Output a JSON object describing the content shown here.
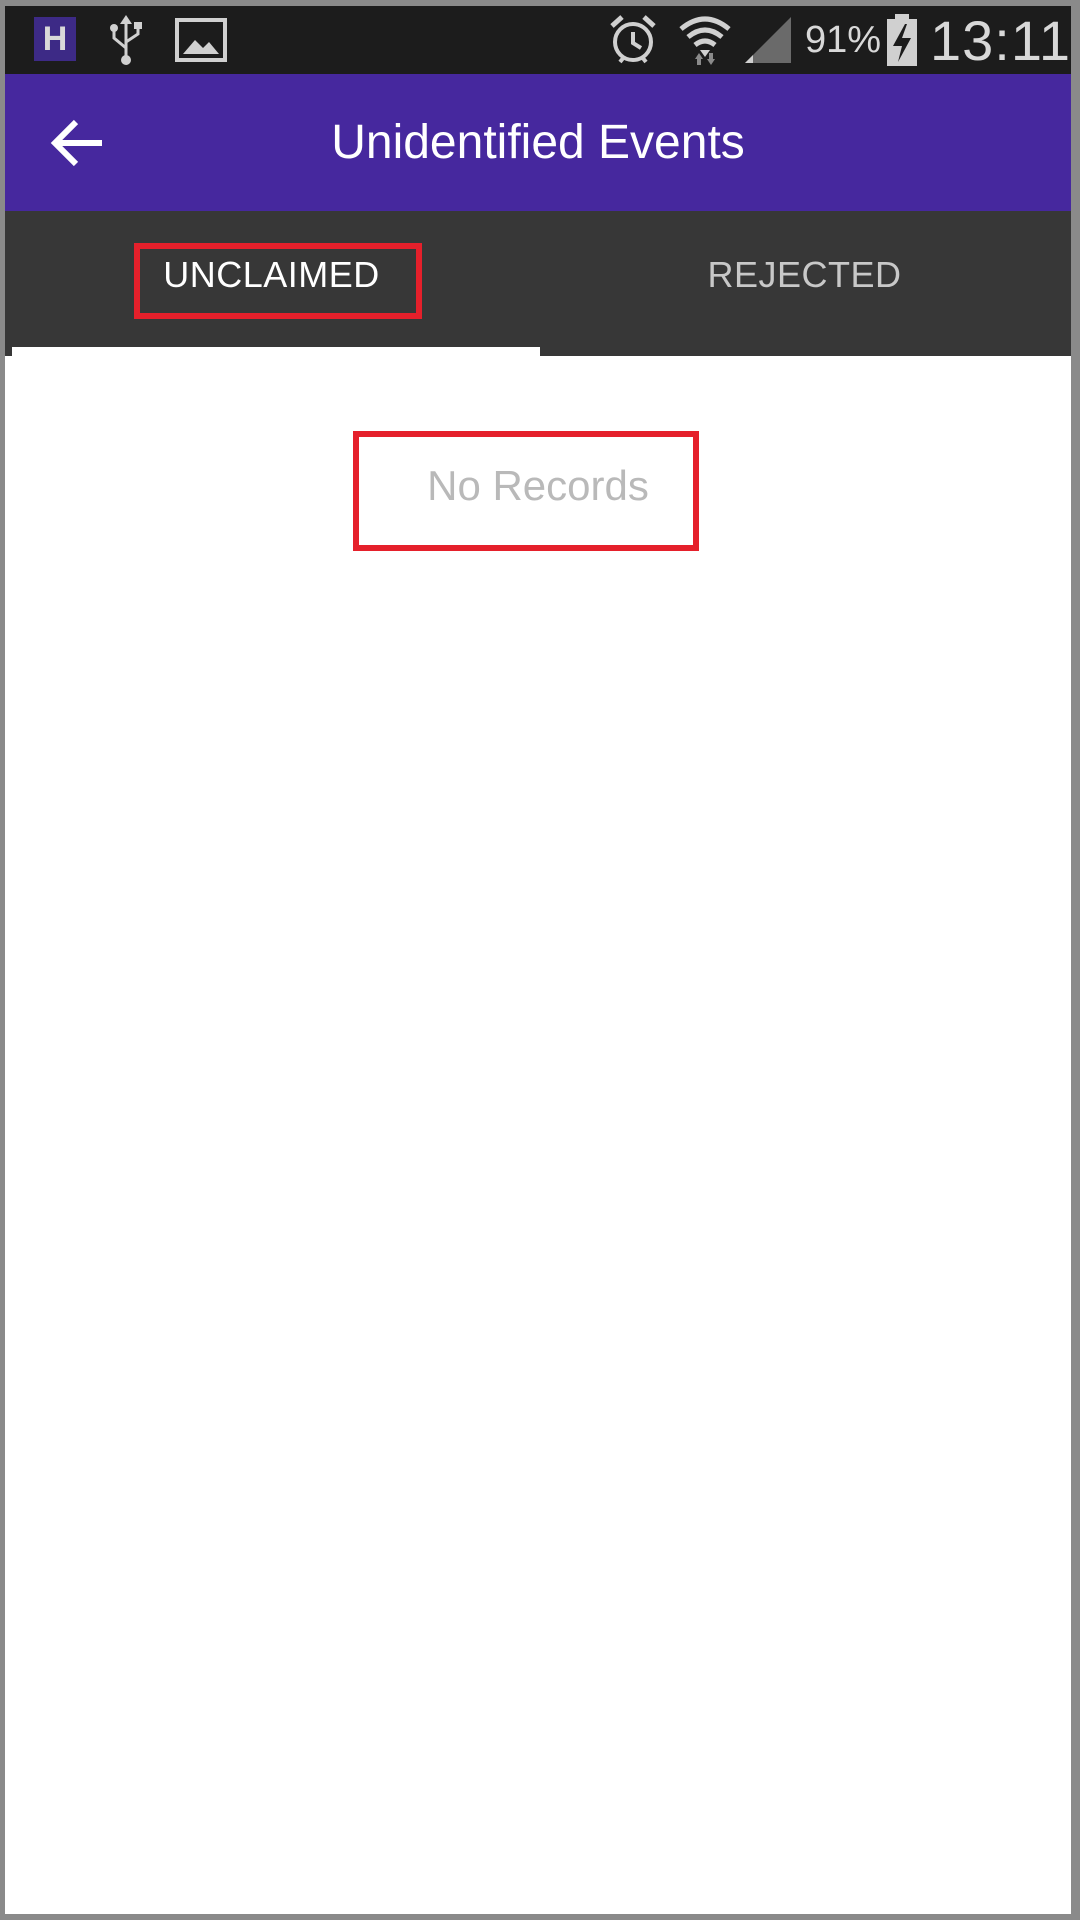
{
  "status_bar": {
    "app_badge": "H",
    "icons": [
      "usb-icon",
      "image-icon",
      "alarm-icon",
      "wifi-icon",
      "signal-icon",
      "battery-charging-icon"
    ],
    "battery_percent": "91%",
    "time": "13:11"
  },
  "app_bar": {
    "title": "Unidentified Events",
    "background": "#46289e"
  },
  "tabs": [
    {
      "label": "UNCLAIMED",
      "selected": true
    },
    {
      "label": "REJECTED",
      "selected": false
    }
  ],
  "content": {
    "empty_message": "No Records"
  },
  "colors": {
    "tab_bar": "#373737",
    "highlight_outline": "#e5202b",
    "empty_text": "#b9b9b9"
  }
}
